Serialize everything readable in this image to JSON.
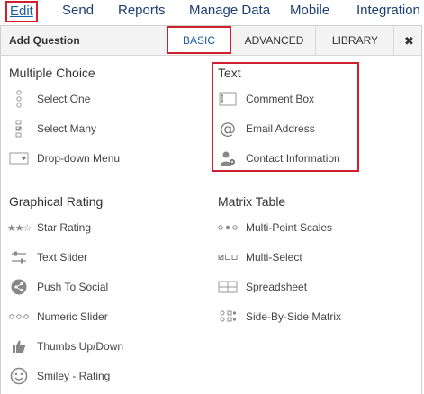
{
  "topnav": {
    "items": [
      "Edit",
      "Send",
      "Reports",
      "Manage Data",
      "Mobile",
      "Integration"
    ]
  },
  "panel": {
    "title": "Add Question",
    "tabs": [
      "BASIC",
      "ADVANCED",
      "LIBRARY"
    ],
    "close": "✖"
  },
  "sections": {
    "multiple_choice": {
      "title": "Multiple Choice",
      "items": [
        "Select One",
        "Select Many",
        "Drop-down Menu"
      ]
    },
    "text": {
      "title": "Text",
      "items": [
        "Comment Box",
        "Email Address",
        "Contact Information"
      ]
    },
    "graphical_rating": {
      "title": "Graphical Rating",
      "items": [
        "Star Rating",
        "Text Slider",
        "Push To Social",
        "Numeric Slider",
        "Thumbs Up/Down",
        "Smiley - Rating"
      ]
    },
    "matrix_table": {
      "title": "Matrix Table",
      "items": [
        "Multi-Point Scales",
        "Multi-Select",
        "Spreadsheet",
        "Side-By-Side Matrix"
      ]
    }
  },
  "colors": {
    "nav_text": "#1b3f73",
    "active_tab": "#1b5ea0",
    "highlight": "#d0202e",
    "icon_gray": "#888888"
  }
}
